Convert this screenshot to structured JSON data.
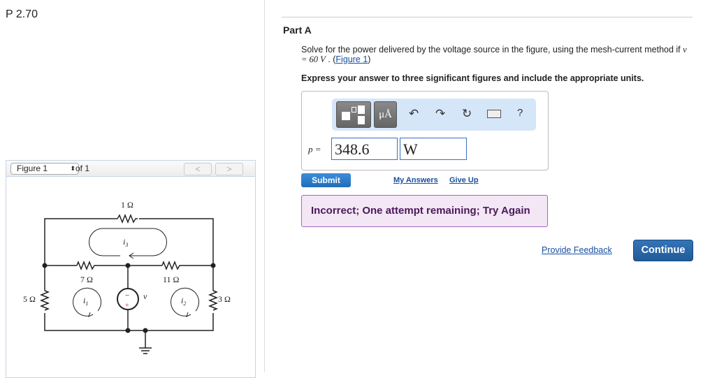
{
  "problem": {
    "title": "P 2.70"
  },
  "figure": {
    "selector": "Figure 1",
    "of": "of 1",
    "prev": "<",
    "next": ">",
    "labels": {
      "r1": "1 Ω",
      "r7": "7 Ω",
      "r11": "11 Ω",
      "r5": "5 Ω",
      "r3": "3 Ω",
      "i1": "i",
      "i1sub": "1",
      "i2": "i",
      "i2sub": "2",
      "i3": "i",
      "i3sub": "3",
      "v": "v",
      "minus": "−",
      "plus": "+"
    }
  },
  "part": {
    "title": "Part A",
    "question_pre": "Solve for the power delivered by the voltage source in the figure, using the mesh-current method if ",
    "question_var": "v = 60 V",
    "question_sep": " . (",
    "figure_link": "Figure 1",
    "question_post": ")",
    "instructions": "Express your answer to three significant figures and include the appropriate units."
  },
  "toolbar": {
    "units": "μÅ",
    "help": "?"
  },
  "answer": {
    "label": "p =",
    "value": "348.6",
    "unit": "W"
  },
  "actions": {
    "submit": "Submit",
    "my_answers": "My Answers",
    "give_up": "Give Up"
  },
  "feedback": {
    "message": "Incorrect; One attempt remaining; Try Again"
  },
  "footer": {
    "provide_feedback": "Provide Feedback",
    "continue": "Continue"
  }
}
